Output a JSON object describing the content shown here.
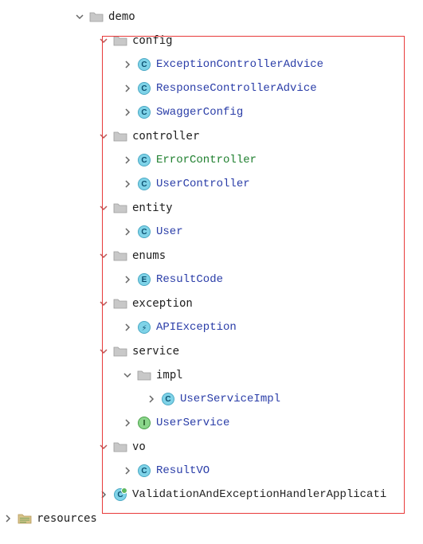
{
  "tree": {
    "demo": "demo",
    "config": "config",
    "config_classes": [
      "ExceptionControllerAdvice",
      "ResponseControllerAdvice",
      "SwaggerConfig"
    ],
    "controller": "controller",
    "controller_classes": [
      "ErrorController",
      "UserController"
    ],
    "entity": "entity",
    "entity_classes": [
      "User"
    ],
    "enums": "enums",
    "enums_classes": [
      "ResultCode"
    ],
    "exception": "exception",
    "exception_classes": [
      "APIException"
    ],
    "service": "service",
    "impl": "impl",
    "impl_classes": [
      "UserServiceImpl"
    ],
    "service_classes": [
      "UserService"
    ],
    "vo": "vo",
    "vo_classes": [
      "ResultVO"
    ],
    "app_class": "ValidationAndExceptionHandlerApplicati",
    "resources": "resources"
  }
}
